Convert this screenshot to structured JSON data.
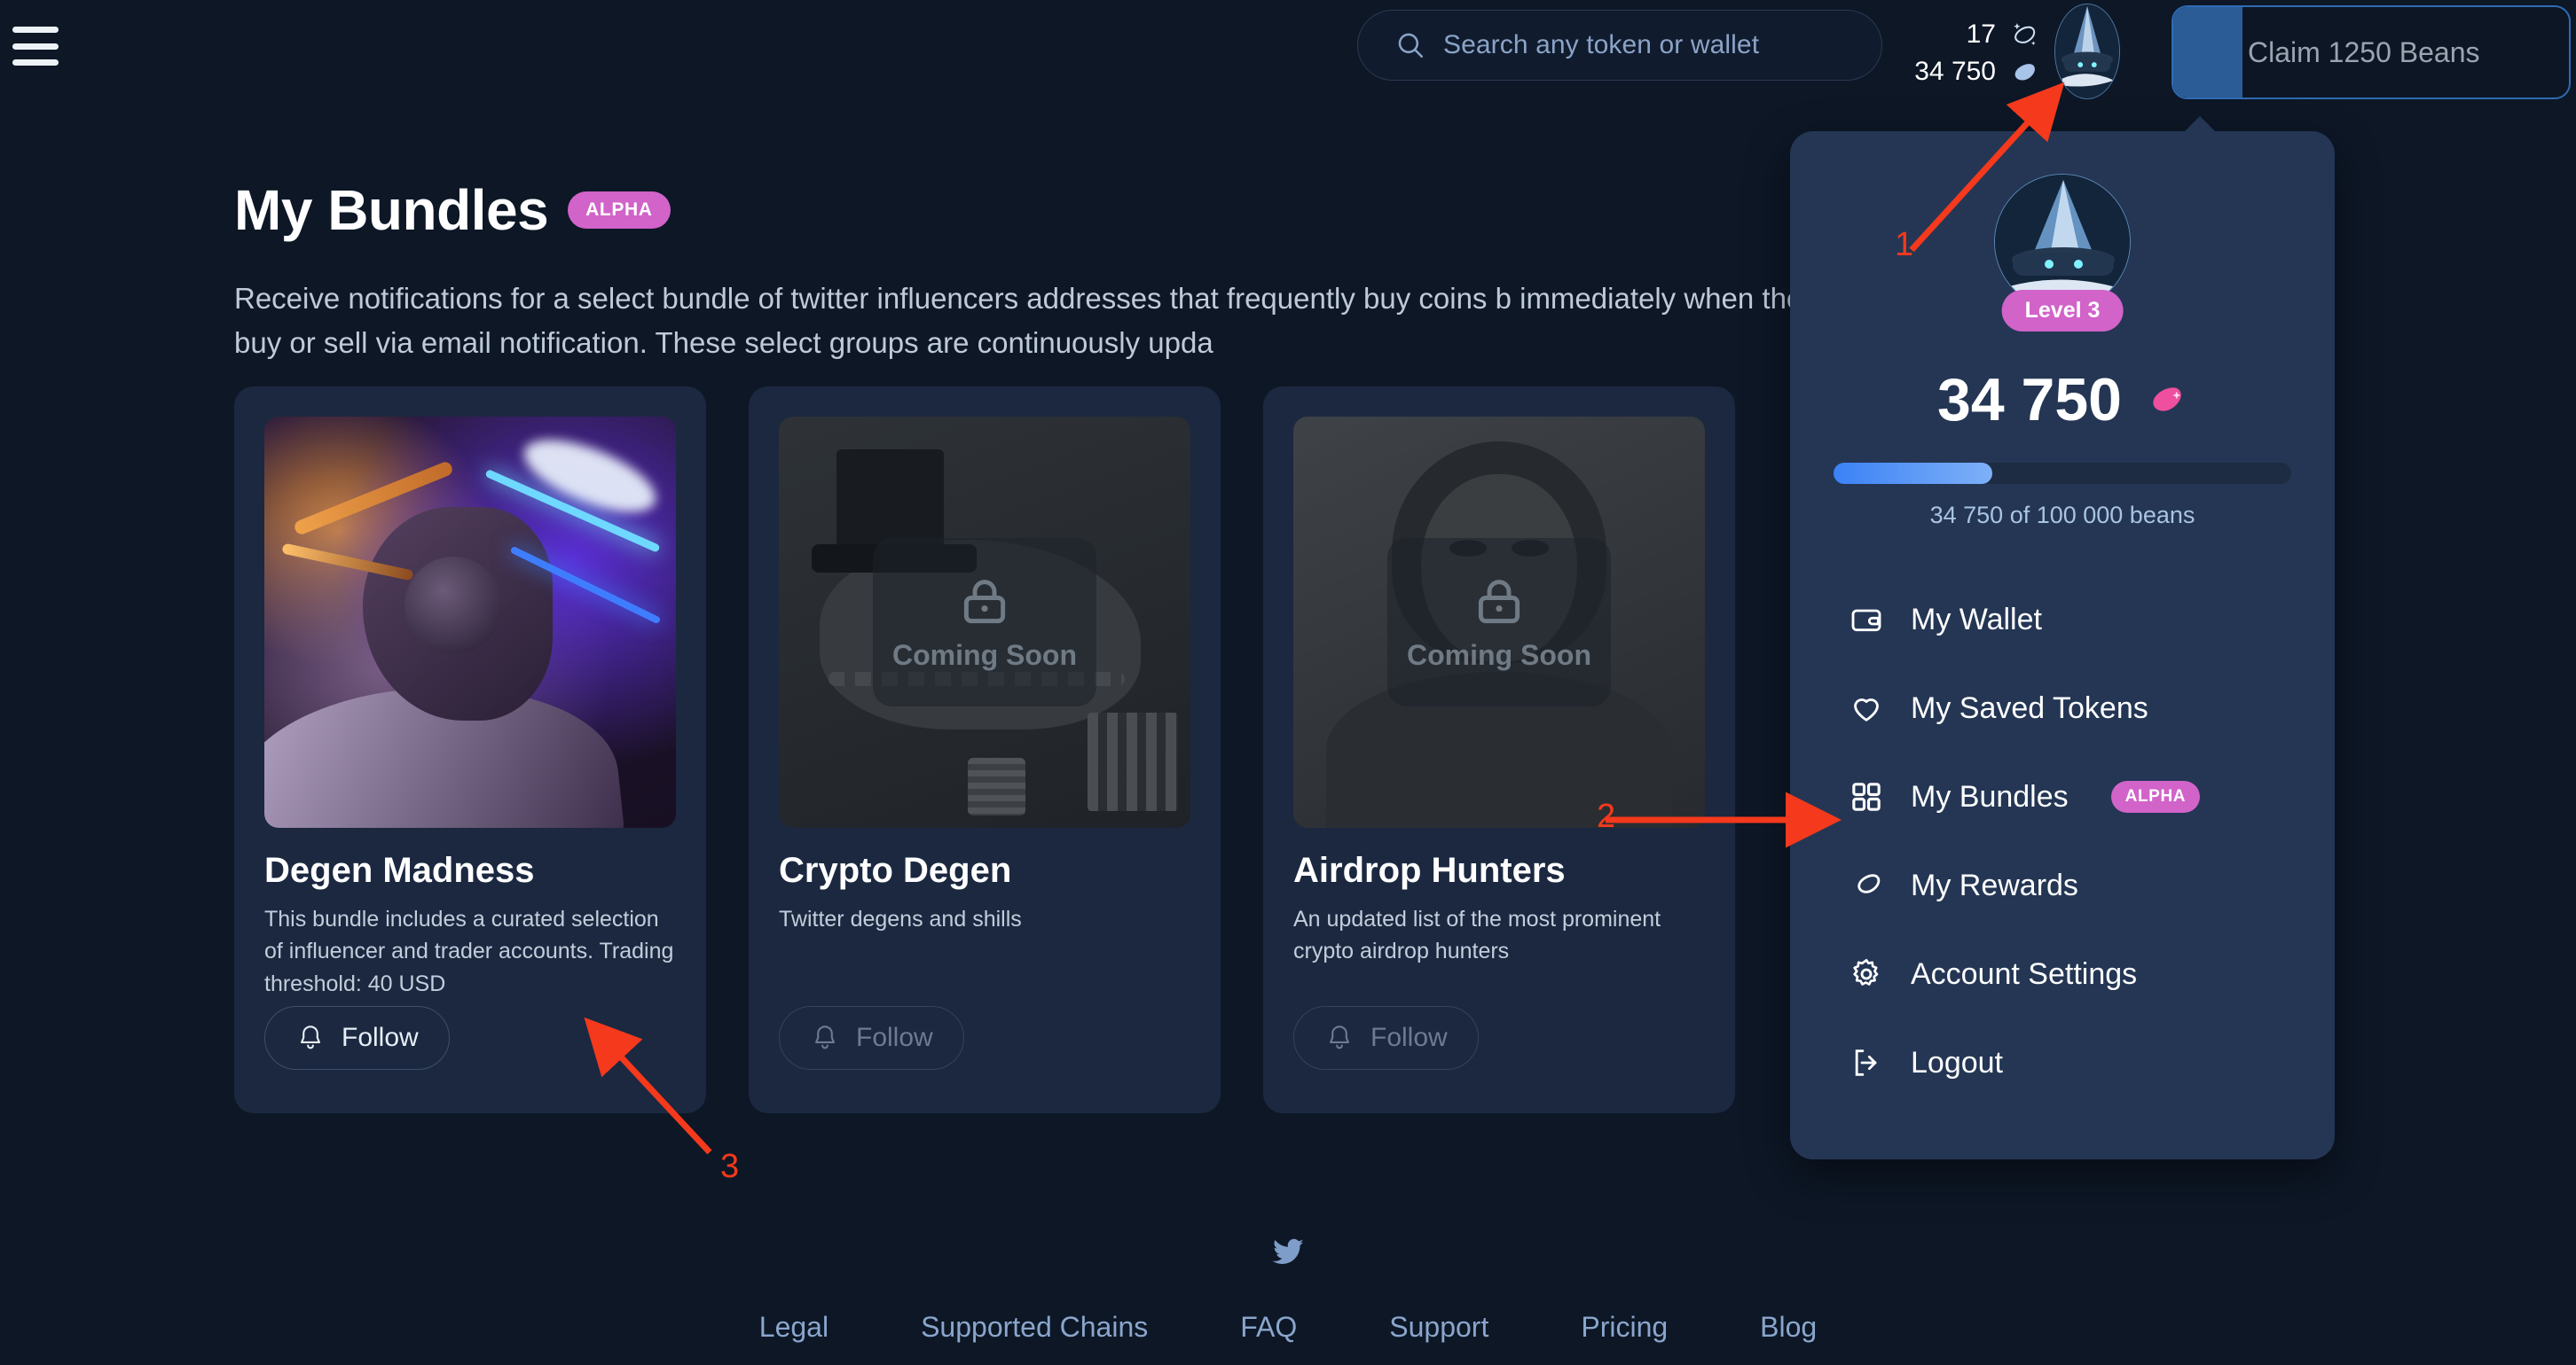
{
  "header": {
    "menu_icon": "hamburger-icon",
    "search": {
      "placeholder": "Search any token or wallet",
      "icon": "search-icon"
    },
    "streak_count": "17",
    "streak_icon": "sparkle-bean-icon",
    "beans_count": "34 750",
    "beans_icon": "bean-icon",
    "avatar_alt": "wizard-avatar",
    "claim_label": "Claim 1250 Beans"
  },
  "main": {
    "title": "My Bundles",
    "title_badge": "ALPHA",
    "description": "Receive notifications for a select bundle of twitter influencers addresses that frequently buy coins b immediately when they buy or sell via email notification. These select groups are continuously upda",
    "cards": [
      {
        "title": "Degen Madness",
        "description": "This bundle includes a curated selection of influencer and trader accounts. Trading threshold: 40 USD",
        "follow_label": "Follow",
        "locked": false,
        "locked_label": ""
      },
      {
        "title": "Crypto Degen",
        "description": "Twitter degens and shills",
        "follow_label": "Follow",
        "locked": true,
        "locked_label": "Coming Soon"
      },
      {
        "title": "Airdrop Hunters",
        "description": "An updated list of the most prominent crypto airdrop hunters",
        "follow_label": "Follow",
        "locked": true,
        "locked_label": "Coming Soon"
      }
    ]
  },
  "dropdown": {
    "level_badge": "Level 3",
    "beans_total": "34 750",
    "progress_percent": 34.75,
    "progress_label": "34 750 of 100 000 beans",
    "items": [
      {
        "label": "My Wallet",
        "icon": "wallet-icon",
        "badge": ""
      },
      {
        "label": "My Saved Tokens",
        "icon": "heart-icon",
        "badge": ""
      },
      {
        "label": "My Bundles",
        "icon": "grid-icon",
        "badge": "ALPHA"
      },
      {
        "label": "My Rewards",
        "icon": "bean-icon",
        "badge": ""
      },
      {
        "label": "Account Settings",
        "icon": "gear-icon",
        "badge": ""
      },
      {
        "label": "Logout",
        "icon": "logout-icon",
        "badge": ""
      }
    ]
  },
  "footer": {
    "social_icon": "twitter-icon",
    "links": [
      "Legal",
      "Supported Chains",
      "FAQ",
      "Support",
      "Pricing",
      "Blog"
    ]
  },
  "annotations": [
    {
      "number": "1",
      "target": "header-avatar-button"
    },
    {
      "number": "2",
      "target": "dropdown-item-my-bundles"
    },
    {
      "number": "3",
      "target": "card-degen-madness-description"
    }
  ],
  "colors": {
    "page_bg": "#0d1726",
    "card_bg": "#1b2840",
    "dropdown_bg": "#243654",
    "accent_pink": "#d163c9",
    "accent_blue": "#3b82f6",
    "annotation_red": "#f4391c",
    "muted_text": "#8aa6cc"
  }
}
